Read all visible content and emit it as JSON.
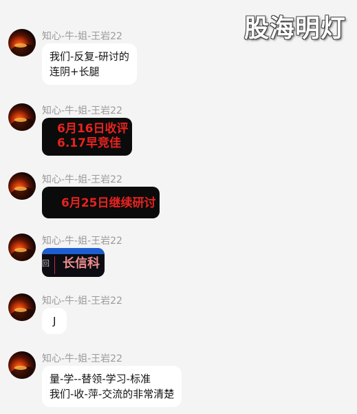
{
  "watermark": "股海明灯",
  "messages": [
    {
      "sender": "知心-牛-姐-王岩22",
      "lines": [
        "我们-反复-研讨的",
        "连阴+长腿"
      ]
    },
    {
      "sender": "知心-牛-姐-王岩22",
      "image_lines": [
        "6月16日收评",
        "6.17早竞佳"
      ]
    },
    {
      "sender": "知心-牛-姐-王岩22",
      "image_lines": [
        "6月25日继续研讨"
      ]
    },
    {
      "sender": "知心-牛-姐-王岩22",
      "image_lines": [
        "长信科"
      ],
      "image_side": "回"
    },
    {
      "sender": "知心-牛-姐-王岩22",
      "lines": [
        "J"
      ]
    },
    {
      "sender": "知心-牛-姐-王岩22",
      "lines": [
        "量-学--替领-学习-标准",
        "我们-收-萍-交流的非常清楚"
      ]
    }
  ]
}
